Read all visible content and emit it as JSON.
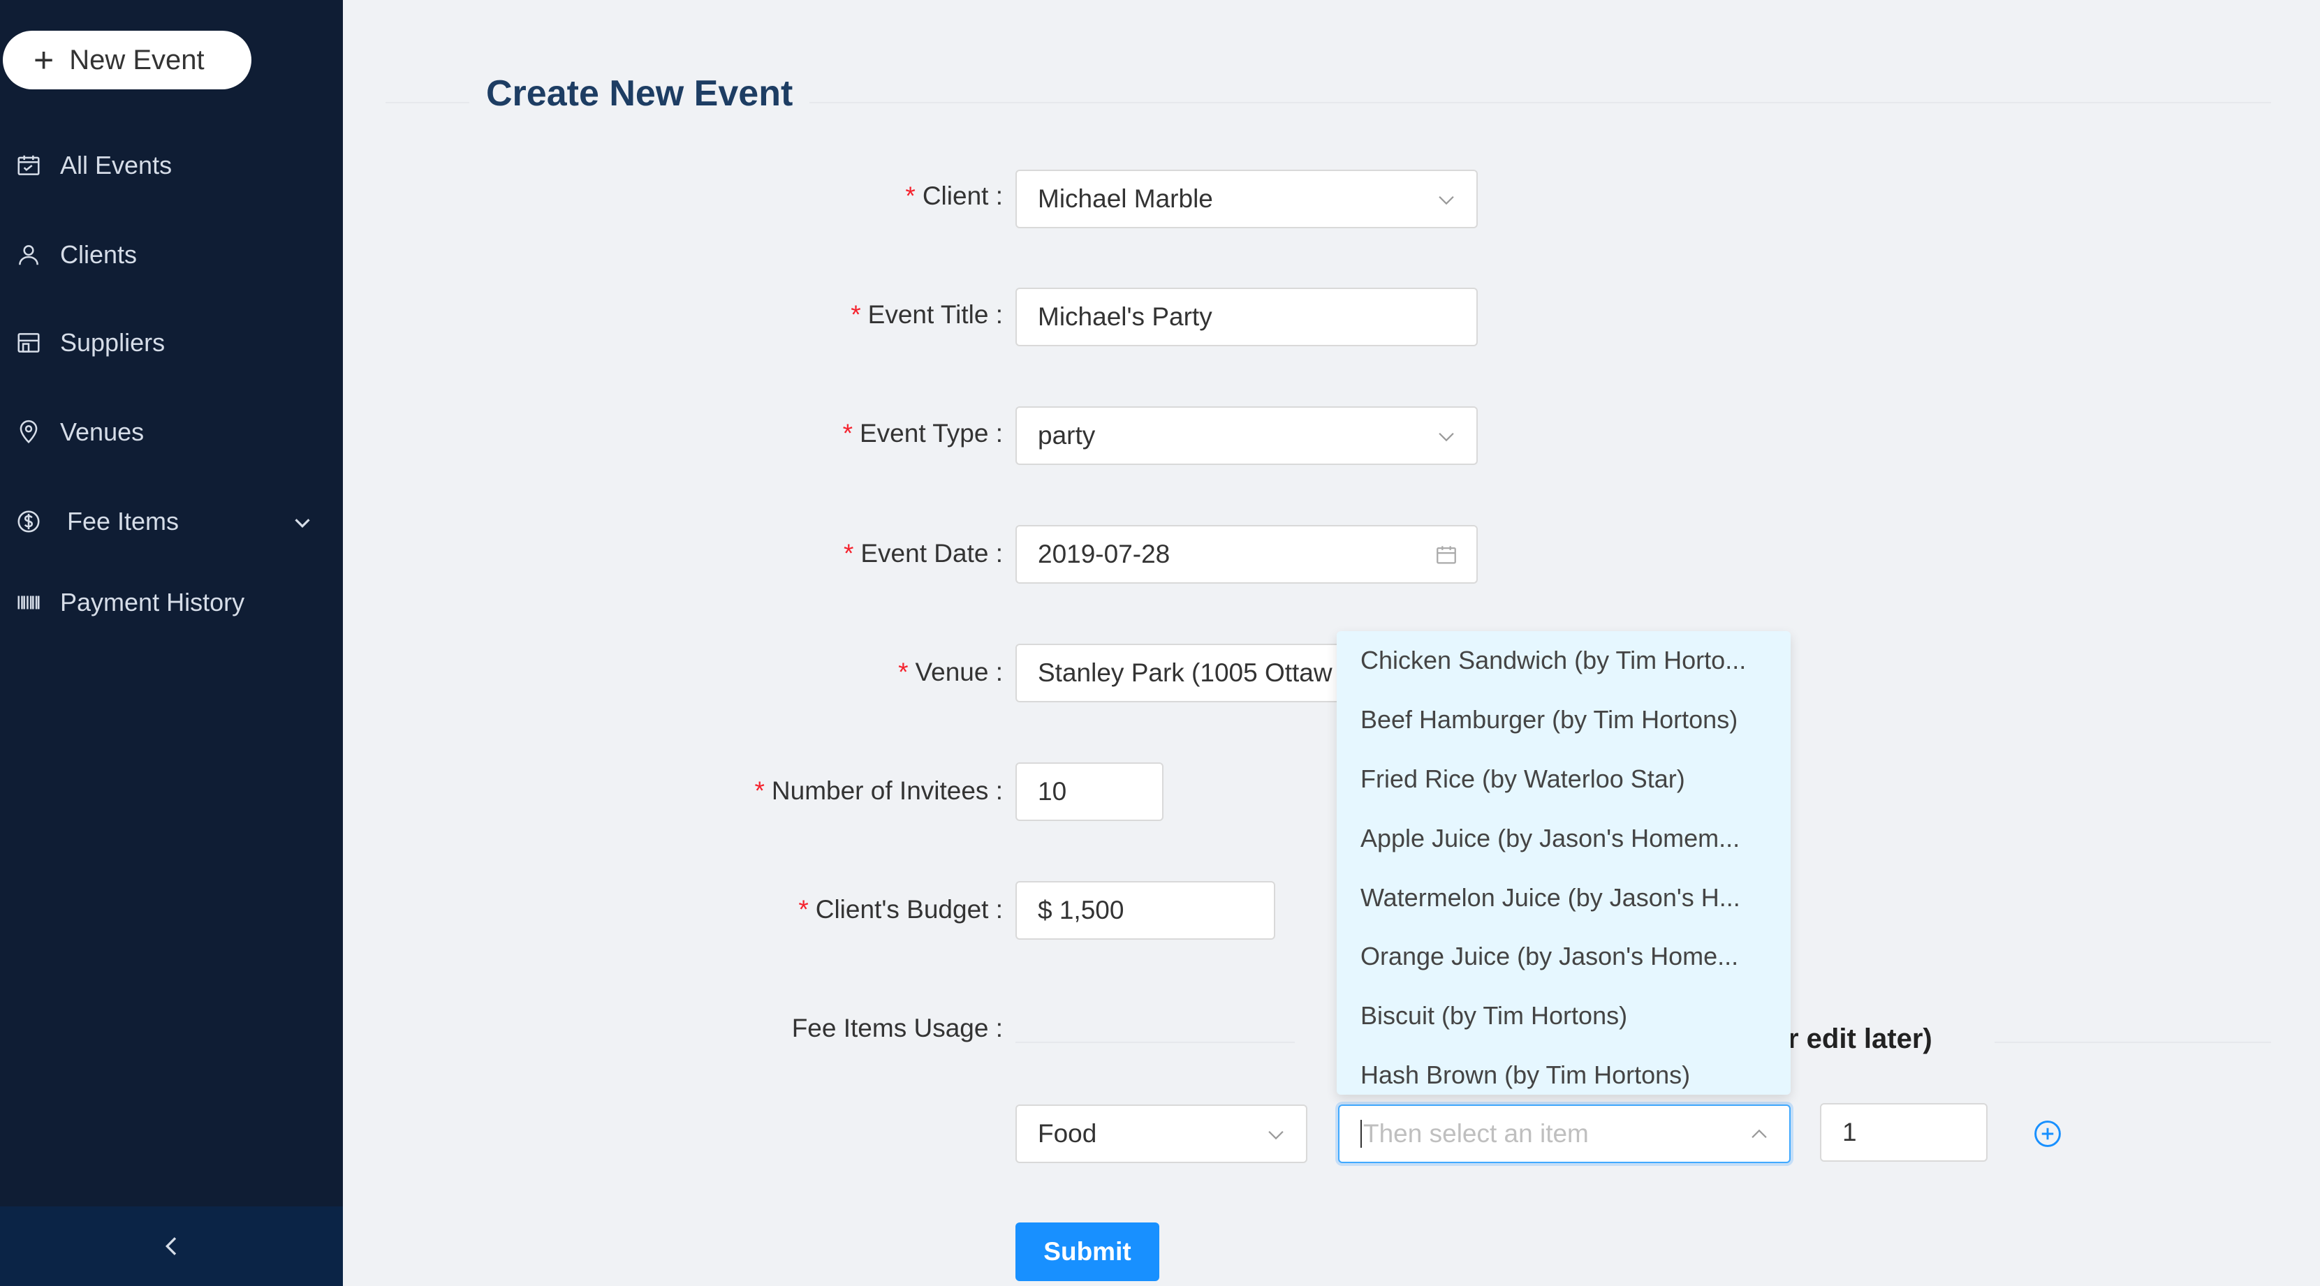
{
  "sidebar": {
    "new_event_label": "New Event",
    "items": [
      {
        "label": "All Events",
        "icon": "calendar-icon"
      },
      {
        "label": "Clients",
        "icon": "user-icon"
      },
      {
        "label": "Suppliers",
        "icon": "shop-icon"
      },
      {
        "label": "Venues",
        "icon": "location-icon"
      },
      {
        "label": "Fee Items",
        "icon": "dollar-icon"
      },
      {
        "label": "Payment History",
        "icon": "barcode-icon"
      }
    ]
  },
  "page": {
    "title": "Create New Event"
  },
  "form": {
    "client": {
      "label": "Client",
      "value": "Michael Marble"
    },
    "event_title": {
      "label": "Event Title",
      "value": "Michael's Party"
    },
    "event_type": {
      "label": "Event Type",
      "value": "party"
    },
    "event_date": {
      "label": "Event Date",
      "value": "2019-07-28"
    },
    "venue": {
      "label": "Venue",
      "value": "Stanley Park (1005 Ottaw"
    },
    "invitees": {
      "label": "Number of Invitees",
      "value": "10"
    },
    "budget": {
      "label": "Client's Budget",
      "value": "$ 1,500"
    },
    "fee_items": {
      "label": "Fee Items Usage",
      "section_text": "r edit later)",
      "category_value": "Food",
      "item_placeholder": "Then select an item",
      "quantity_value": "1"
    },
    "submit_label": "Submit"
  },
  "dropdown_options": [
    "Chicken Sandwich (by Tim Horto...",
    "Beef Hamburger (by Tim Hortons)",
    "Fried Rice (by Waterloo Star)",
    "Apple Juice (by Jason's Homem...",
    "Watermelon Juice (by Jason's H...",
    "Orange Juice (by Jason's Home...",
    "Biscuit (by Tim Hortons)",
    "Hash Brown (by Tim Hortons)"
  ],
  "colors": {
    "sidebar_bg": "#0f1d34",
    "primary": "#1890ff",
    "title": "#1d3d63",
    "required": "#f5222d",
    "dropdown_bg": "#e6f7ff"
  }
}
